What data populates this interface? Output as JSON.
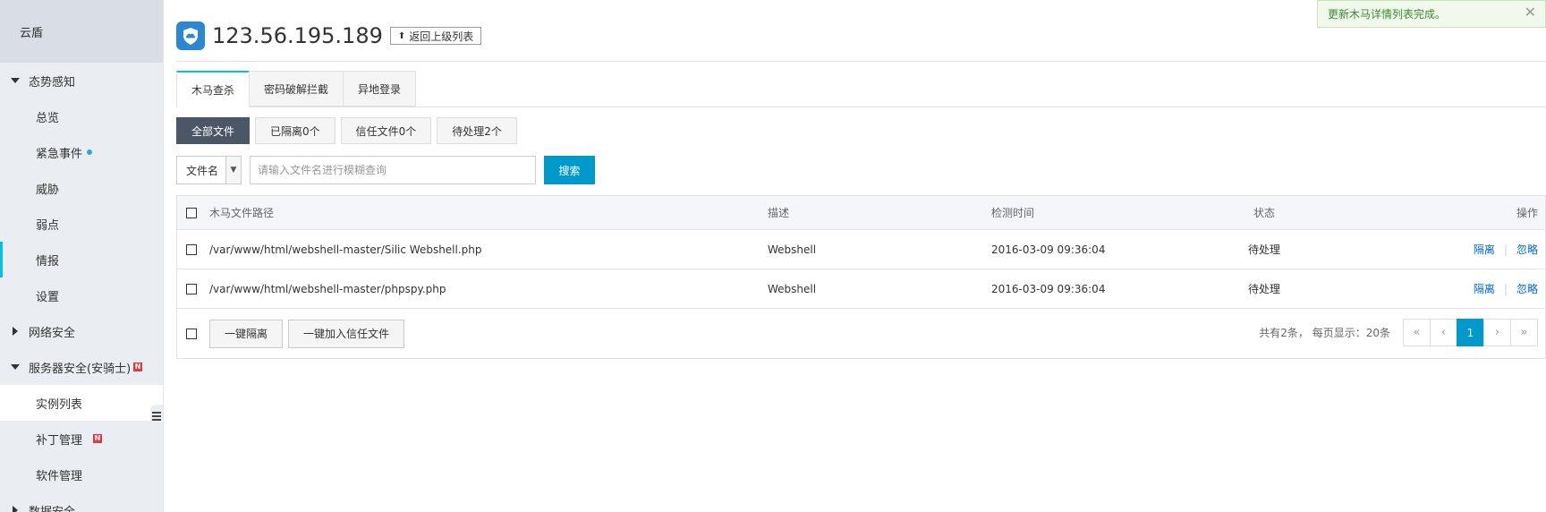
{
  "sidebar": {
    "title": "云盾",
    "groups": [
      {
        "label": "态势感知"
      },
      {
        "label": "网络安全"
      },
      {
        "label": "服务器安全(安骑士)",
        "badge": "N"
      },
      {
        "label": "数据安全"
      }
    ],
    "items": [
      {
        "label": "总览"
      },
      {
        "label": "紧急事件"
      },
      {
        "label": "威胁"
      },
      {
        "label": "弱点"
      },
      {
        "label": "情报"
      },
      {
        "label": "设置"
      },
      {
        "label": "实例列表"
      },
      {
        "label": "补丁管理",
        "badge": "N"
      },
      {
        "label": "软件管理"
      }
    ]
  },
  "header": {
    "ip": "123.56.195.189",
    "back_label": "返回上级列表"
  },
  "toast": {
    "message": "更新木马详情列表完成。",
    "close": "✕"
  },
  "tabs": [
    {
      "label": "木马查杀",
      "active": true
    },
    {
      "label": "密码破解拦截"
    },
    {
      "label": "异地登录"
    }
  ],
  "filters": [
    {
      "label": "全部文件",
      "active": true
    },
    {
      "label": "已隔离0个"
    },
    {
      "label": "信任文件0个"
    },
    {
      "label": "待处理2个"
    }
  ],
  "search": {
    "field_select": "文件名",
    "placeholder": "请输入文件名进行模糊查询",
    "button": "搜索"
  },
  "table": {
    "columns": [
      "木马文件路径",
      "描述",
      "检测时间",
      "状态",
      "操作"
    ],
    "rows": [
      {
        "path": "/var/www/html/webshell-master/Silic Webshell.php",
        "desc": "Webshell",
        "time": "2016-03-09 09:36:04",
        "status": "待处理",
        "action1": "隔离",
        "action2": "忽略"
      },
      {
        "path": "/var/www/html/webshell-master/phpspy.php",
        "desc": "Webshell",
        "time": "2016-03-09 09:36:04",
        "status": "待处理",
        "action1": "隔离",
        "action2": "忽略"
      }
    ],
    "bulk_isolate": "一键隔离",
    "bulk_trust": "一键加入信任文件",
    "pagination": {
      "info": "共有2条， 每页显示：20条",
      "first": "«",
      "prev": "‹",
      "current": "1",
      "next": "›",
      "last": "»"
    }
  },
  "colors": {
    "accent": "#0099cc",
    "tab_accent": "#00c1de",
    "shield": "#2b87d1",
    "sidebar_bg": "#eaedf1"
  }
}
